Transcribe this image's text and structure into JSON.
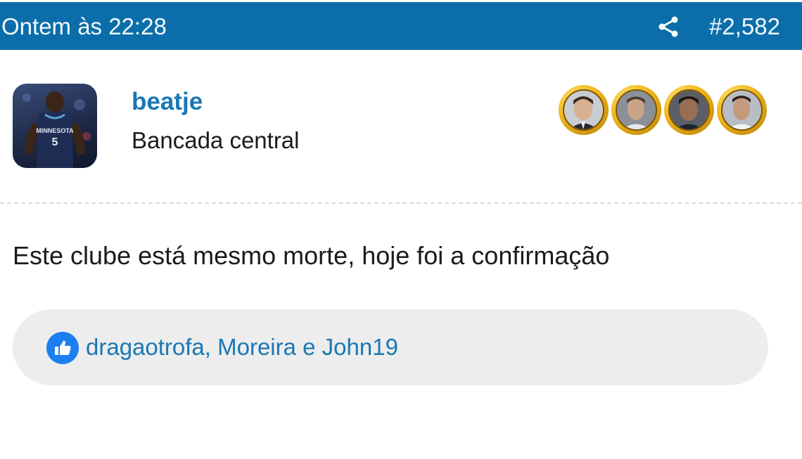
{
  "header": {
    "timestamp": "Ontem às 22:28",
    "share_icon": "share-icon",
    "post_number": "#2,582"
  },
  "author": {
    "username": "beatje",
    "title": "Bancada central",
    "avatar_jersey_text": "MINNESOTA",
    "avatar_jersey_number": "5"
  },
  "badges": [
    {
      "icon": "trophy-badge-icon"
    },
    {
      "icon": "trophy-badge-icon"
    },
    {
      "icon": "trophy-badge-icon"
    },
    {
      "icon": "trophy-badge-icon"
    }
  ],
  "post": {
    "message": "Este clube está mesmo morte, hoje foi a confirmação"
  },
  "reactions": {
    "icon": "thumbs-up-icon",
    "likers_text": "dragaotrofa, Moreira e John19"
  },
  "colors": {
    "header_bg": "#0b6eaa",
    "link": "#1a78b4",
    "like_icon": "#1d7ef0",
    "likes_bg": "#ededed"
  }
}
